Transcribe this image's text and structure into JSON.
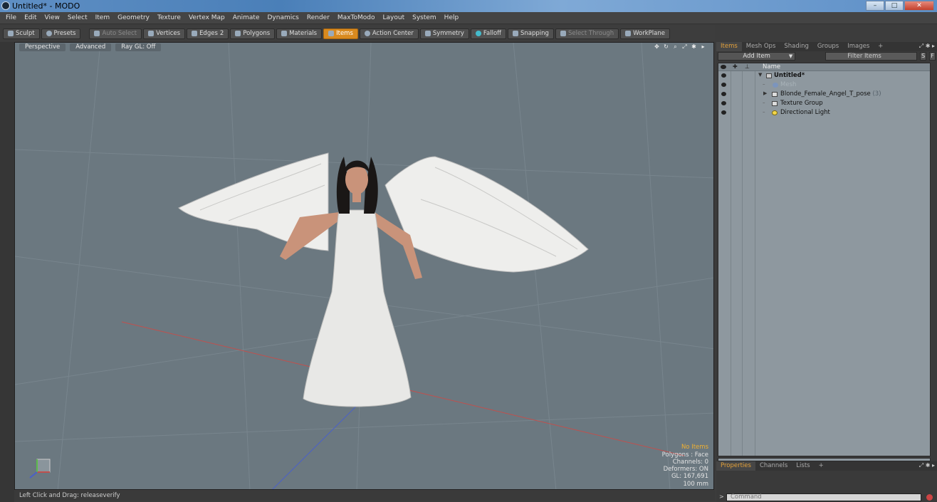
{
  "window": {
    "title": "Untitled* - MODO",
    "controls": [
      "–",
      "□",
      "✕"
    ]
  },
  "menu": [
    "File",
    "Edit",
    "View",
    "Select",
    "Item",
    "Geometry",
    "Texture",
    "Vertex Map",
    "Animate",
    "Dynamics",
    "Render",
    "MaxToModo",
    "Layout",
    "System",
    "Help"
  ],
  "toolbar": {
    "sculpt": "Sculpt",
    "presets": "Presets",
    "auto_select": "Auto Select",
    "vertices": "Vertices",
    "edges": "Edges",
    "polygons_count": "2",
    "polygons": "Polygons",
    "materials": "Materials",
    "items": "Items",
    "action_center": "Action Center",
    "symmetry": "Symmetry",
    "falloff": "Falloff",
    "snapping": "Snapping",
    "select_through": "Select Through",
    "workplane": "WorkPlane"
  },
  "viewport": {
    "tabs": [
      "Perspective",
      "Advanced",
      "Ray GL: Off"
    ],
    "info": {
      "items": "No Items",
      "polygons": "Polygons : Face",
      "channels": "Channels: 0",
      "deformers": "Deformers: ON",
      "gl": "GL: 167,691",
      "scale": "100 mm"
    },
    "colors": {
      "background": "#6b7880",
      "grid": "#78858d",
      "x_axis": "#c0504d",
      "z_axis": "#4a60c8",
      "dress": "#e8e8e6",
      "wings": "#eeeeec",
      "hair": "#1a1716",
      "skin": "#c9937a"
    }
  },
  "status": {
    "hint": "Left Click and Drag:  releaseverify"
  },
  "panel": {
    "top_tabs": [
      "Items",
      "Mesh Ops",
      "Shading",
      "Groups",
      "Images",
      "+"
    ],
    "add_item": "Add Item",
    "filter_placeholder": "Filter Items",
    "s_btn": "S",
    "f_btn": "F",
    "column_name": "Name",
    "tree": [
      {
        "label": "Untitled*",
        "count": ""
      },
      {
        "label": "Mesh",
        "count": ""
      },
      {
        "label": "Blonde_Female_Angel_T_pose",
        "count": "(3)"
      },
      {
        "label": "Texture Group",
        "count": ""
      },
      {
        "label": "Directional Light",
        "count": ""
      }
    ],
    "bottom_tabs": [
      "Properties",
      "Channels",
      "Lists",
      "+"
    ],
    "command_placeholder": "Command",
    "command_prompt": ">"
  }
}
